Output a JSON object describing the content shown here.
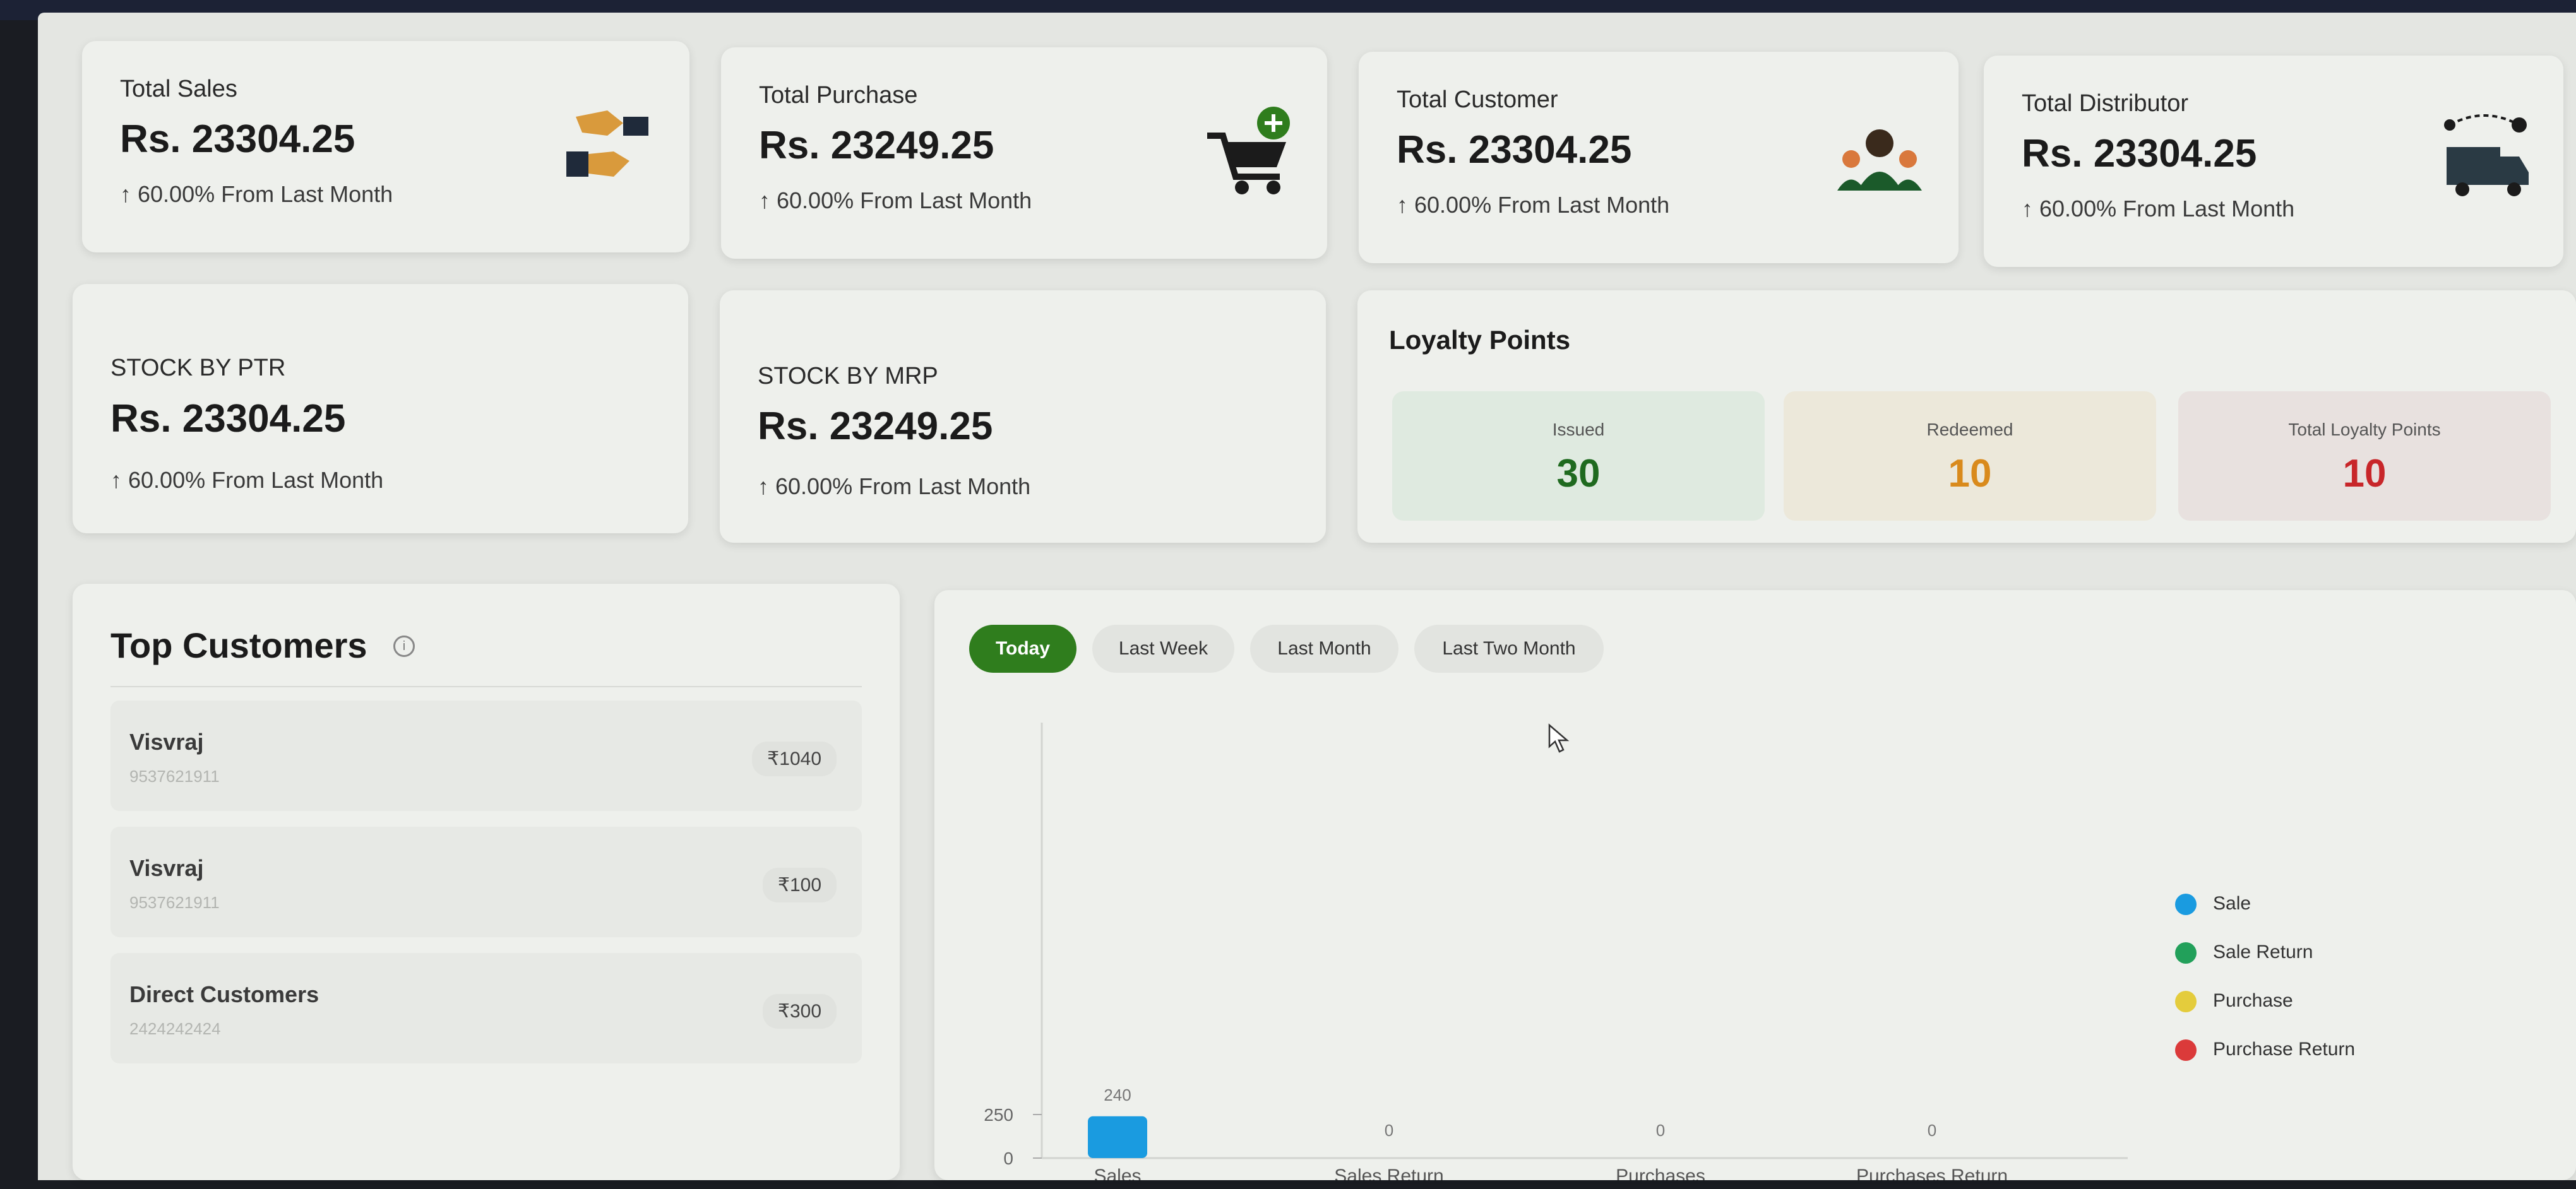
{
  "stats": [
    {
      "label": "Total Sales",
      "value": "Rs. 23304.25",
      "change": "↑ 60.00% From Last Month",
      "icon": "handshake-icon"
    },
    {
      "label": "Total Purchase",
      "value": "Rs. 23249.25",
      "change": "↑ 60.00% From Last Month",
      "icon": "cart-add-icon"
    },
    {
      "label": "Total Customer",
      "value": "Rs. 23304.25",
      "change": "↑ 60.00% From Last Month",
      "icon": "customers-icon"
    },
    {
      "label": "Total Distributor",
      "value": "Rs. 23304.25",
      "change": "↑ 60.00% From Last Month",
      "icon": "delivery-truck-icon"
    }
  ],
  "stock": [
    {
      "label": "STOCK BY PTR",
      "value": "Rs. 23304.25",
      "change": "↑ 60.00% From Last Month"
    },
    {
      "label": "STOCK BY MRP",
      "value": "Rs. 23249.25",
      "change": "↑ 60.00% From Last Month"
    }
  ],
  "loyalty": {
    "title": "Loyalty Points",
    "issued_label": "Issued",
    "issued_value": "30",
    "redeemed_label": "Redeemed",
    "redeemed_value": "10",
    "total_label": "Total Loyalty Points",
    "total_value": "10"
  },
  "top_customers": {
    "title": "Top Customers",
    "rows": [
      {
        "name": "Visvraj",
        "phone": "9537621911",
        "amount": "₹1040"
      },
      {
        "name": "Visvraj",
        "phone": "9537621911",
        "amount": "₹100"
      },
      {
        "name": "Direct Customers",
        "phone": "2424242424",
        "amount": "₹300"
      }
    ]
  },
  "tabs": [
    "Today",
    "Last Week",
    "Last Month",
    "Last Two Month"
  ],
  "colors": {
    "accent_green": "#2f7d1d",
    "sale": "#1a9be0",
    "sale_return": "#22a05a",
    "purchase": "#e4cc3c",
    "purchase_return": "#db3a3a"
  },
  "chart_data": {
    "type": "bar",
    "categories": [
      "Sales",
      "Sales Return",
      "Purchases",
      "Purchases Return"
    ],
    "values": [
      240,
      0,
      0,
      0
    ],
    "data_labels": [
      "240",
      "0",
      "0",
      "0"
    ],
    "ylim": [
      0,
      2500
    ],
    "y_ticks": [
      "0",
      "250"
    ],
    "legend": [
      "Sale",
      "Sale Return",
      "Purchase",
      "Purchase Return"
    ],
    "legend_position": "right"
  }
}
